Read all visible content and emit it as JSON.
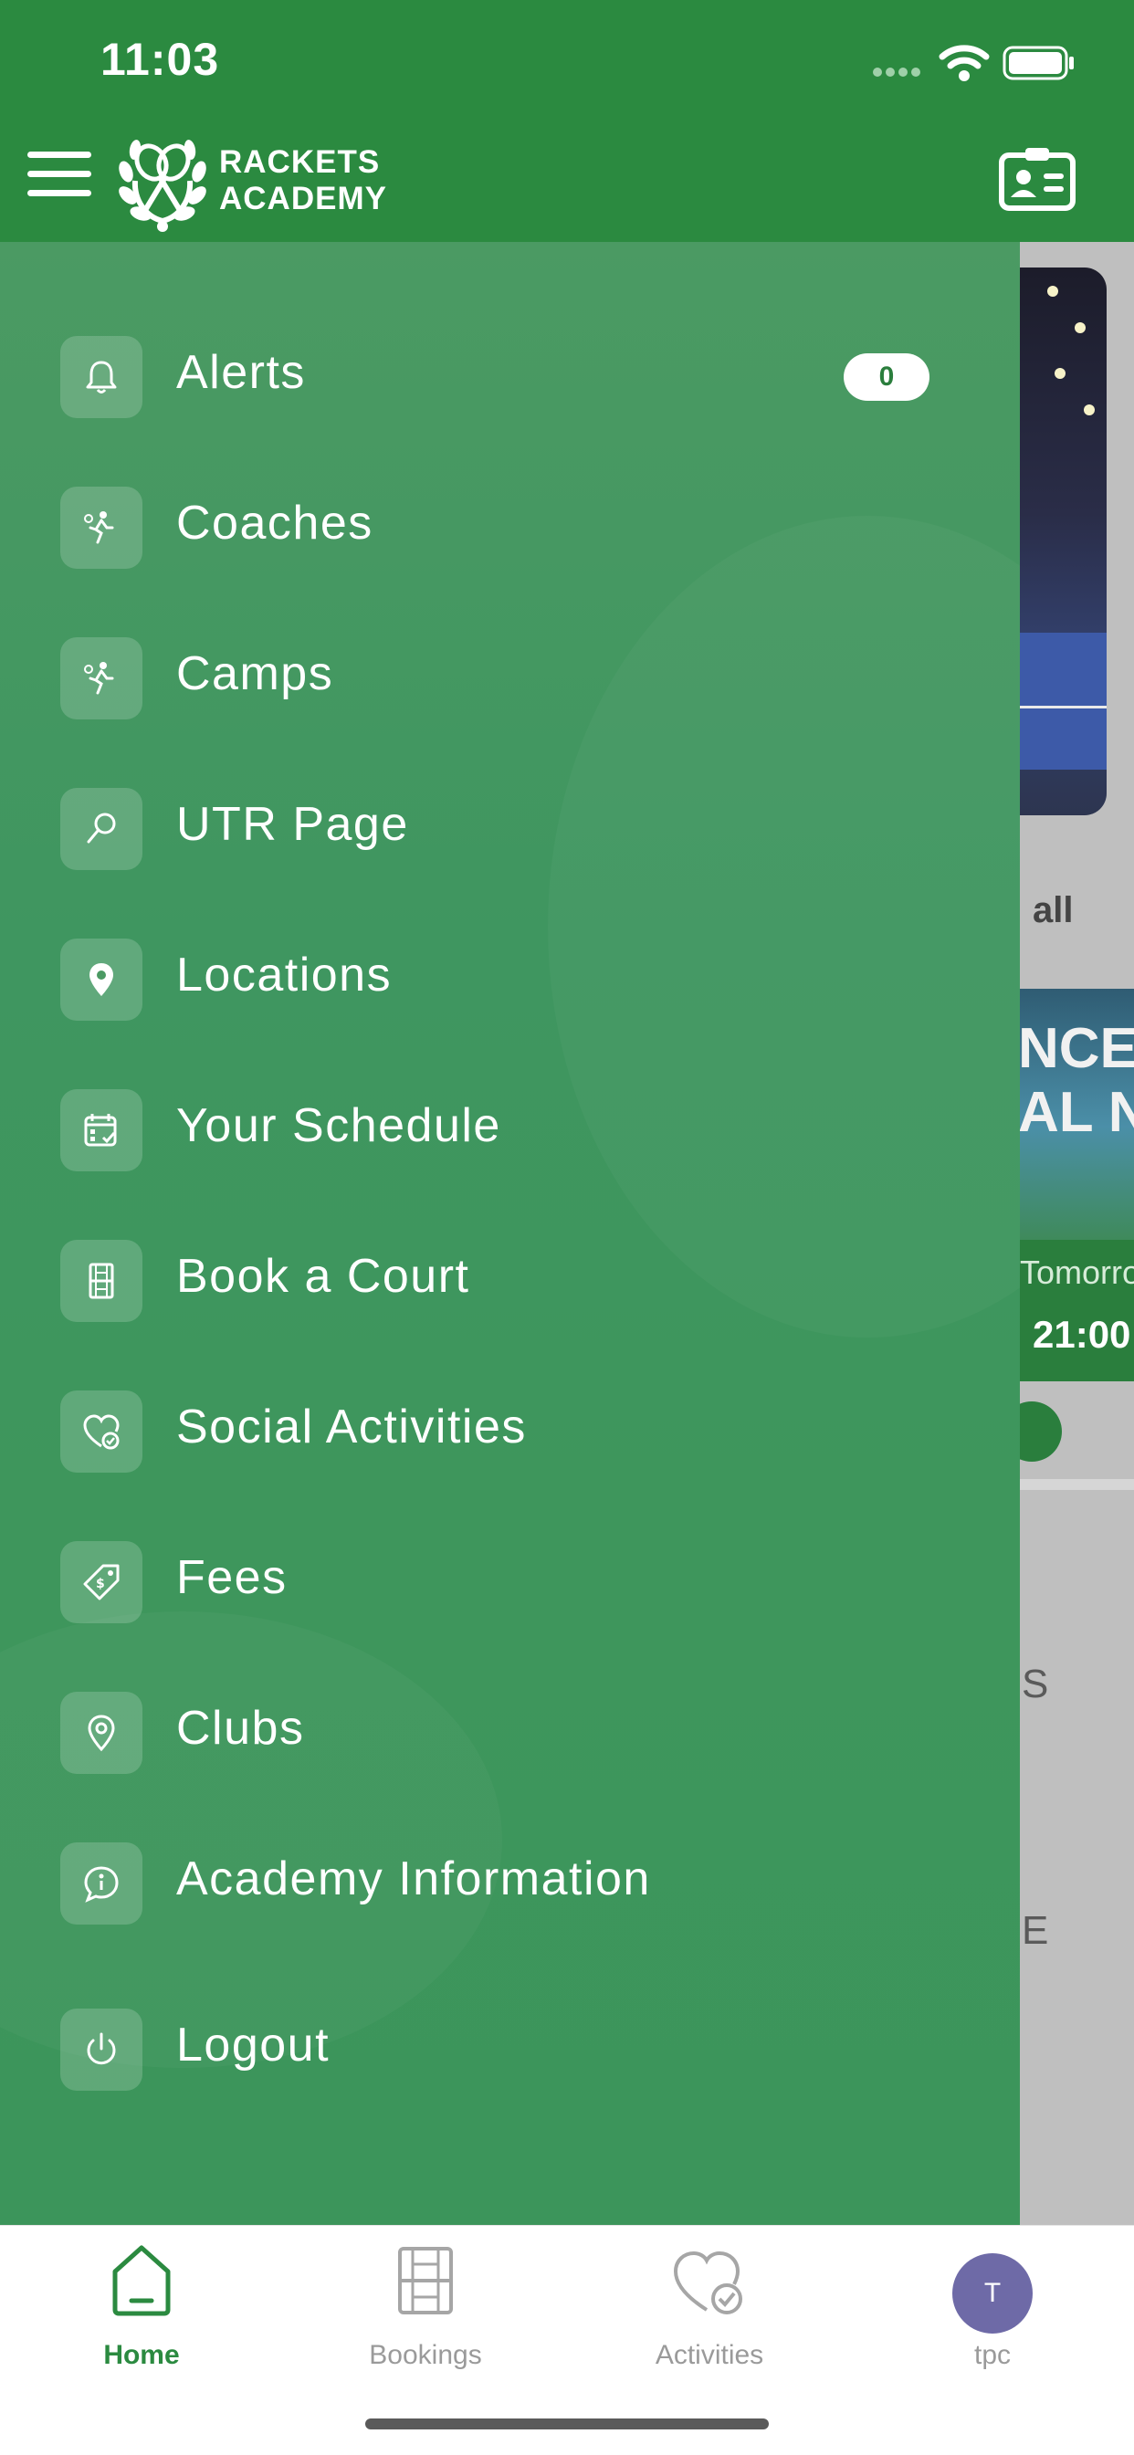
{
  "status_bar": {
    "time": "11:03"
  },
  "header": {
    "logo_line1": "RACKETS",
    "logo_line2": "ACADEMY",
    "menu_icon": "hamburger-icon",
    "profile_icon": "id-card-icon"
  },
  "drawer": {
    "items": [
      {
        "label": "Alerts",
        "icon": "bell-icon",
        "badge": "0"
      },
      {
        "label": "Coaches",
        "icon": "player-icon"
      },
      {
        "label": "Camps",
        "icon": "player-icon"
      },
      {
        "label": "UTR Page",
        "icon": "racket-icon"
      },
      {
        "label": "Locations",
        "icon": "location-pin-icon"
      },
      {
        "label": "Your Schedule",
        "icon": "calendar-check-icon"
      },
      {
        "label": "Book a Court",
        "icon": "court-icon"
      },
      {
        "label": "Social Activities",
        "icon": "heart-check-icon"
      },
      {
        "label": "Fees",
        "icon": "price-tag-icon"
      },
      {
        "label": "Clubs",
        "icon": "location-outline-icon"
      },
      {
        "label": "Academy Information",
        "icon": "info-chat-icon"
      },
      {
        "label": "Logout",
        "icon": "power-icon"
      }
    ]
  },
  "background_page": {
    "see_all": "all",
    "card_title_line1": "NCE",
    "card_title_line2": "AL NI",
    "card_day": "Tomorro",
    "card_time": "21:00",
    "section_s": "S",
    "section_e": "E"
  },
  "tabbar": {
    "tabs": [
      {
        "label": "Home",
        "icon": "home-icon",
        "active": true
      },
      {
        "label": "Bookings",
        "icon": "court-icon",
        "active": false
      },
      {
        "label": "Activities",
        "icon": "heart-check-icon",
        "active": false
      },
      {
        "label": "tpc",
        "avatar_initial": "T",
        "active": false
      }
    ]
  },
  "colors": {
    "brand_green": "#2b8a40",
    "drawer_green": "#3f9660",
    "avatar": "#6e6aa7"
  }
}
